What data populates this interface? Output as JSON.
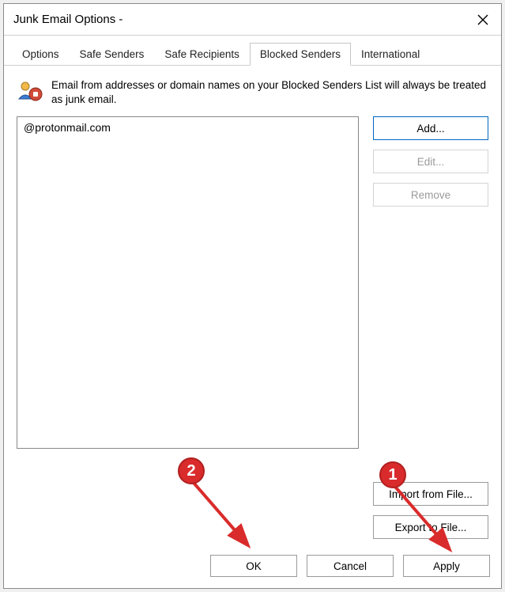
{
  "window": {
    "title": "Junk Email Options -"
  },
  "tabs": {
    "items": [
      "Options",
      "Safe Senders",
      "Safe Recipients",
      "Blocked Senders",
      "International"
    ],
    "active_index": 3
  },
  "description": "Email from addresses or domain names on your Blocked Senders List will always be treated as junk email.",
  "blocked_list": {
    "items": [
      "@protonmail.com"
    ]
  },
  "side_buttons": {
    "add": "Add...",
    "edit": "Edit...",
    "remove": "Remove",
    "import": "Import from File...",
    "export": "Export to File..."
  },
  "dialog_buttons": {
    "ok": "OK",
    "cancel": "Cancel",
    "apply": "Apply"
  },
  "annotations": {
    "one": "1",
    "two": "2"
  }
}
